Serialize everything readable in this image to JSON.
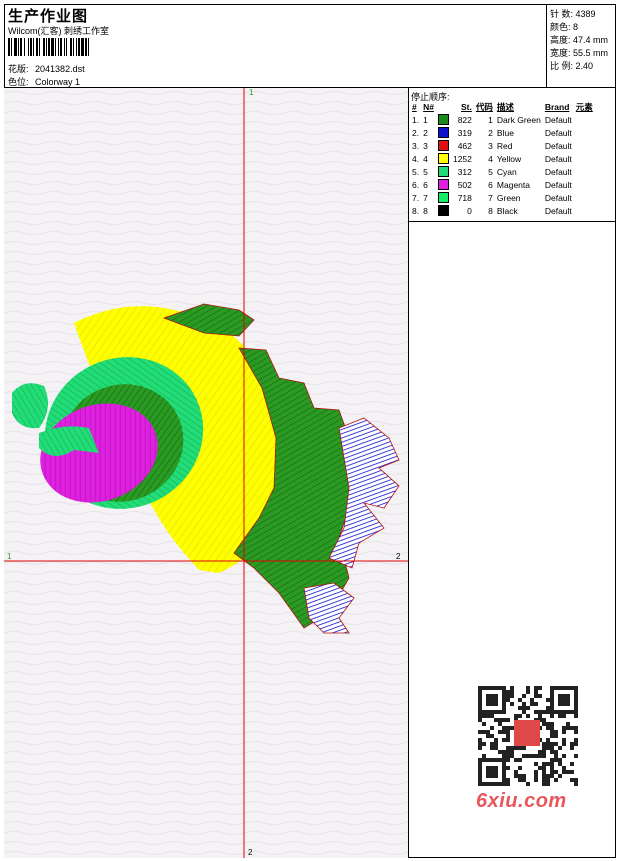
{
  "header": {
    "title": "生产作业图",
    "studio": "Wilcom(汇客) 刺绣工作室",
    "design_label": "花版:",
    "design_value": "2041382.dst",
    "colorway_label": "色位:",
    "colorway_value": "Colorway 1"
  },
  "stats": [
    {
      "label": "针 数:",
      "value": "4389"
    },
    {
      "label": "颜色:",
      "value": "8"
    },
    {
      "label": "高度:",
      "value": "47.4 mm"
    },
    {
      "label": "宽度:",
      "value": "55.5 mm"
    },
    {
      "label": "比 例:",
      "value": "2.40"
    }
  ],
  "legend": {
    "title": "停止顺序:",
    "headers": [
      "#",
      "N#",
      "St.",
      "代码",
      "描述",
      "Brand",
      "元素"
    ],
    "rows": [
      {
        "idx": "1.",
        "n": "1",
        "st": "822",
        "code": "1",
        "desc": "Dark Green",
        "brand": "Default",
        "color": "#1a8a1a"
      },
      {
        "idx": "2.",
        "n": "2",
        "st": "319",
        "code": "2",
        "desc": "Blue",
        "brand": "Default",
        "color": "#1010d0"
      },
      {
        "idx": "3.",
        "n": "3",
        "st": "462",
        "code": "3",
        "desc": "Red",
        "brand": "Default",
        "color": "#e01010"
      },
      {
        "idx": "4.",
        "n": "4",
        "st": "1252",
        "code": "4",
        "desc": "Yellow",
        "brand": "Default",
        "color": "#ffff00"
      },
      {
        "idx": "5.",
        "n": "5",
        "st": "312",
        "code": "5",
        "desc": "Cyan",
        "brand": "Default",
        "color": "#22dd77"
      },
      {
        "idx": "6.",
        "n": "6",
        "st": "502",
        "code": "6",
        "desc": "Magenta",
        "brand": "Default",
        "color": "#e020e0"
      },
      {
        "idx": "7.",
        "n": "7",
        "st": "718",
        "code": "7",
        "desc": "Green",
        "brand": "Default",
        "color": "#11ee66"
      },
      {
        "idx": "8.",
        "n": "8",
        "st": "0",
        "code": "8",
        "desc": "Black",
        "brand": "Default",
        "color": "#000000"
      }
    ]
  },
  "axes": {
    "top": "1",
    "bottom": "2",
    "left": "1",
    "right": "2"
  },
  "watermark": "6xiu.com",
  "qr_stamp": "汉字图库"
}
